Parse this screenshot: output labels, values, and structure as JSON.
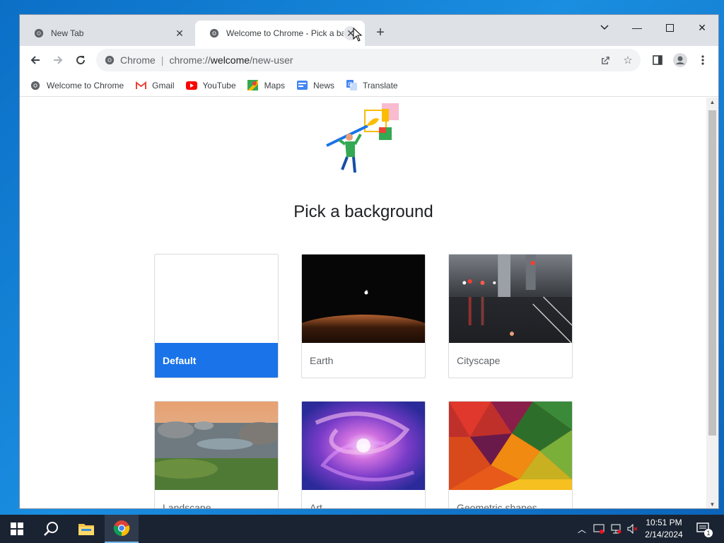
{
  "tabs": [
    {
      "title": "New Tab",
      "active": false
    },
    {
      "title": "Welcome to Chrome - Pick a bac",
      "active": true
    }
  ],
  "omnibox": {
    "chip": "Chrome",
    "url_prefix": "chrome://",
    "url_host": "welcome",
    "url_path": "/new-user"
  },
  "bookmarks": [
    {
      "label": "Welcome to Chrome",
      "icon": "chrome-globe-icon"
    },
    {
      "label": "Gmail",
      "icon": "gmail-icon"
    },
    {
      "label": "YouTube",
      "icon": "youtube-icon"
    },
    {
      "label": "Maps",
      "icon": "maps-icon"
    },
    {
      "label": "News",
      "icon": "news-icon"
    },
    {
      "label": "Translate",
      "icon": "translate-icon"
    }
  ],
  "page": {
    "heading": "Pick a background"
  },
  "backgrounds": [
    {
      "label": "Default",
      "selected": true
    },
    {
      "label": "Earth"
    },
    {
      "label": "Cityscape"
    },
    {
      "label": "Landscape"
    },
    {
      "label": "Art"
    },
    {
      "label": "Geometric shapes"
    }
  ],
  "clock": {
    "time": "10:51 PM",
    "date": "2/14/2024"
  },
  "notifications": {
    "count": "1"
  },
  "colors": {
    "accent": "#1a73e8",
    "tabstrip": "#dee1e6",
    "taskbar": "#1a2331"
  }
}
